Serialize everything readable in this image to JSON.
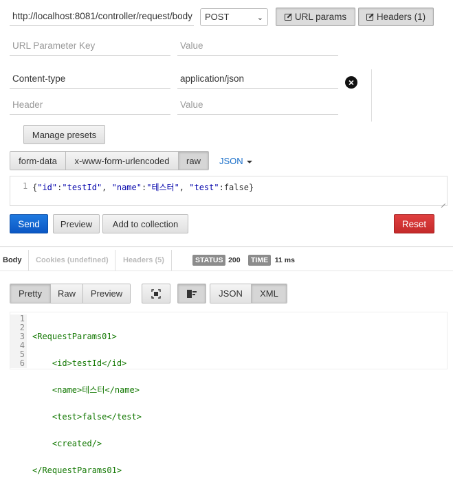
{
  "request": {
    "url": "http://localhost:8081/controller/request/body",
    "method": "POST",
    "url_params_label": "URL params",
    "headers_label": "Headers (1)"
  },
  "url_params": {
    "key_placeholder": "URL Parameter Key",
    "value_placeholder": "Value"
  },
  "headers": {
    "rows": [
      {
        "key": "Content-type",
        "value": "application/json"
      }
    ],
    "key_placeholder": "Header",
    "value_placeholder": "Value"
  },
  "manage_presets_label": "Manage presets",
  "body_tabs": [
    "form-data",
    "x-www-form-urlencoded",
    "raw"
  ],
  "body_active_tab": "raw",
  "body_type_label": "JSON",
  "raw_body": {
    "line_number": "1",
    "parts": [
      "{",
      "\"id\"",
      ":",
      "\"testId\"",
      ", ",
      "\"name\"",
      ":",
      "\"테스터\"",
      ", ",
      "\"test\"",
      ":false}"
    ]
  },
  "actions": {
    "send": "Send",
    "preview": "Preview",
    "add_to_collection": "Add to collection",
    "reset": "Reset"
  },
  "response_tabs": {
    "body": "Body",
    "cookies": "Cookies (undefined)",
    "headers": "Headers (5)"
  },
  "status": {
    "label": "STATUS",
    "value": "200"
  },
  "time": {
    "label": "TIME",
    "value": "11 ms"
  },
  "view_modes": [
    "Pretty",
    "Raw",
    "Preview"
  ],
  "format_modes": [
    "JSON",
    "XML"
  ],
  "response_lines": [
    {
      "n": "1",
      "indent": "",
      "text": "<RequestParams01>"
    },
    {
      "n": "2",
      "indent": "    ",
      "text": "<id>testId</id>"
    },
    {
      "n": "3",
      "indent": "    ",
      "text": "<name>테스터</name>"
    },
    {
      "n": "4",
      "indent": "    ",
      "text": "<test>false</test>"
    },
    {
      "n": "5",
      "indent": "    ",
      "text": "<created/>"
    },
    {
      "n": "6",
      "indent": "",
      "text": "</RequestParams01>"
    }
  ],
  "colors": {
    "send": "#0b57c4",
    "reset": "#c42a2a",
    "json_link": "#1a6fc9",
    "xml_tag": "#117700",
    "json_key": "#0000aa"
  }
}
